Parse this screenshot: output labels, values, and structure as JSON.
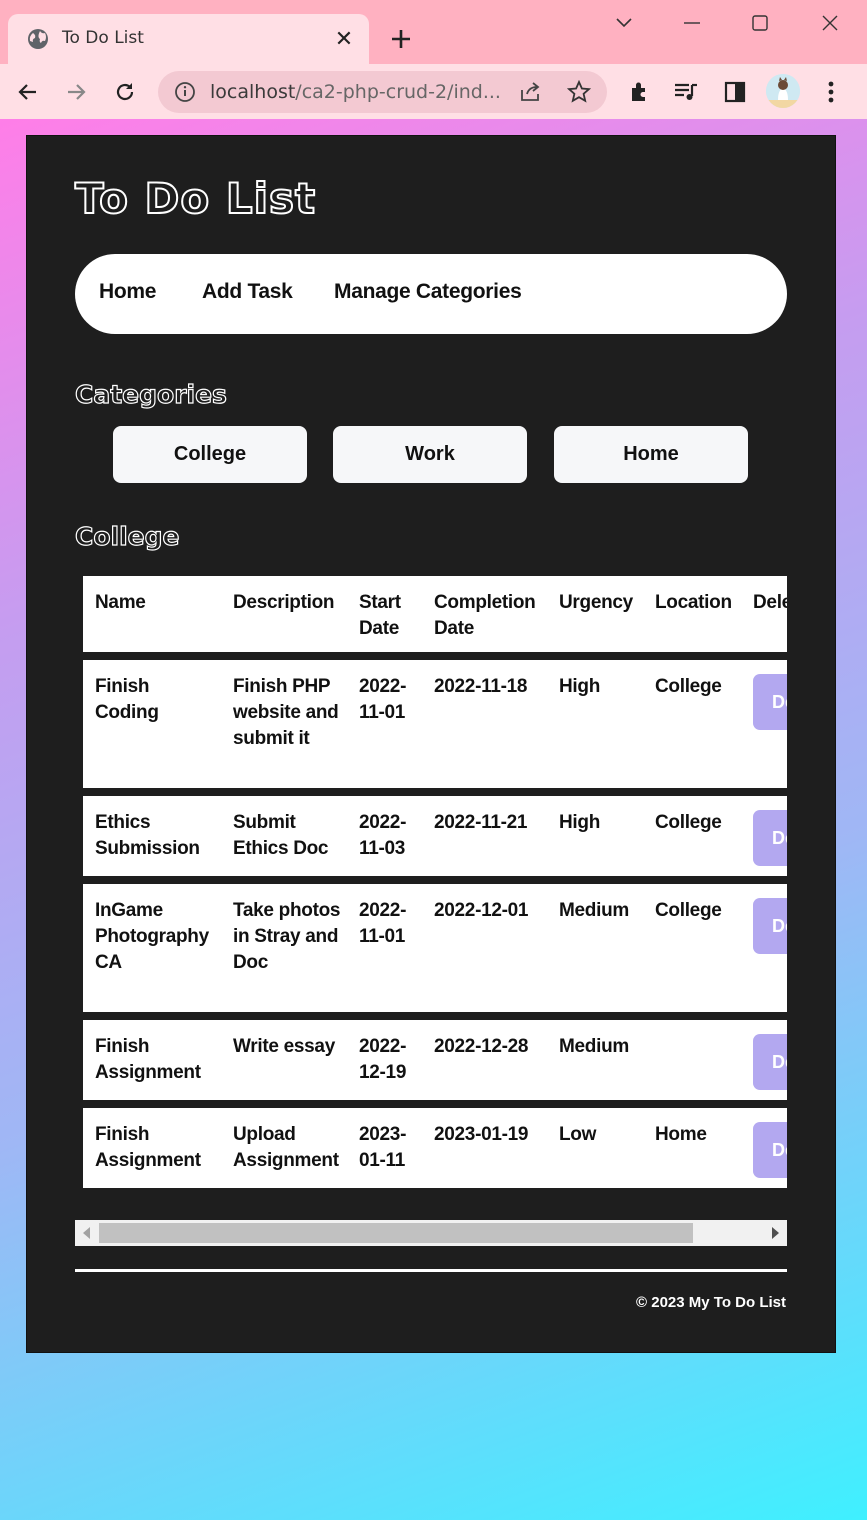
{
  "browser": {
    "tab_title": "To Do List",
    "tab_close": "✕",
    "new_tab": "+",
    "url_host": "localhost",
    "url_rest": "/ca2-php-crud-2/ind..."
  },
  "site": {
    "title": "To Do List",
    "nav": [
      "Home",
      "Add Task",
      "Manage Categories"
    ]
  },
  "categories": {
    "heading": "Categories",
    "items": [
      "College",
      "Work",
      "Home"
    ]
  },
  "tasks": {
    "heading": "College",
    "columns": [
      "Name",
      "Description",
      "Start Date",
      "Completion Date",
      "Urgency",
      "Location",
      "Dele"
    ],
    "delete_label": "Delete",
    "rows": [
      {
        "name": "Finish Coding",
        "description": "Finish PHP website and submit it",
        "start": "2022-11-01",
        "completion": "2022-11-18",
        "urgency": "High",
        "location": "College"
      },
      {
        "name": "Ethics Submission",
        "description": "Submit Ethics Doc",
        "start": "2022-11-03",
        "completion": "2022-11-21",
        "urgency": "High",
        "location": "College"
      },
      {
        "name": "InGame Photography CA",
        "description": "Take photos in Stray and Doc",
        "start": "2022-11-01",
        "completion": "2022-12-01",
        "urgency": "Medium",
        "location": "College"
      },
      {
        "name": "Finish Assignment",
        "description": "Write essay",
        "start": "2022-12-19",
        "completion": "2022-12-28",
        "urgency": "Medium",
        "location": ""
      },
      {
        "name": "Finish Assignment",
        "description": "Upload Assignment",
        "start": "2023-01-11",
        "completion": "2023-01-19",
        "urgency": "Low",
        "location": "Home"
      }
    ]
  },
  "footer": {
    "text": "© 2023 My To Do List"
  }
}
